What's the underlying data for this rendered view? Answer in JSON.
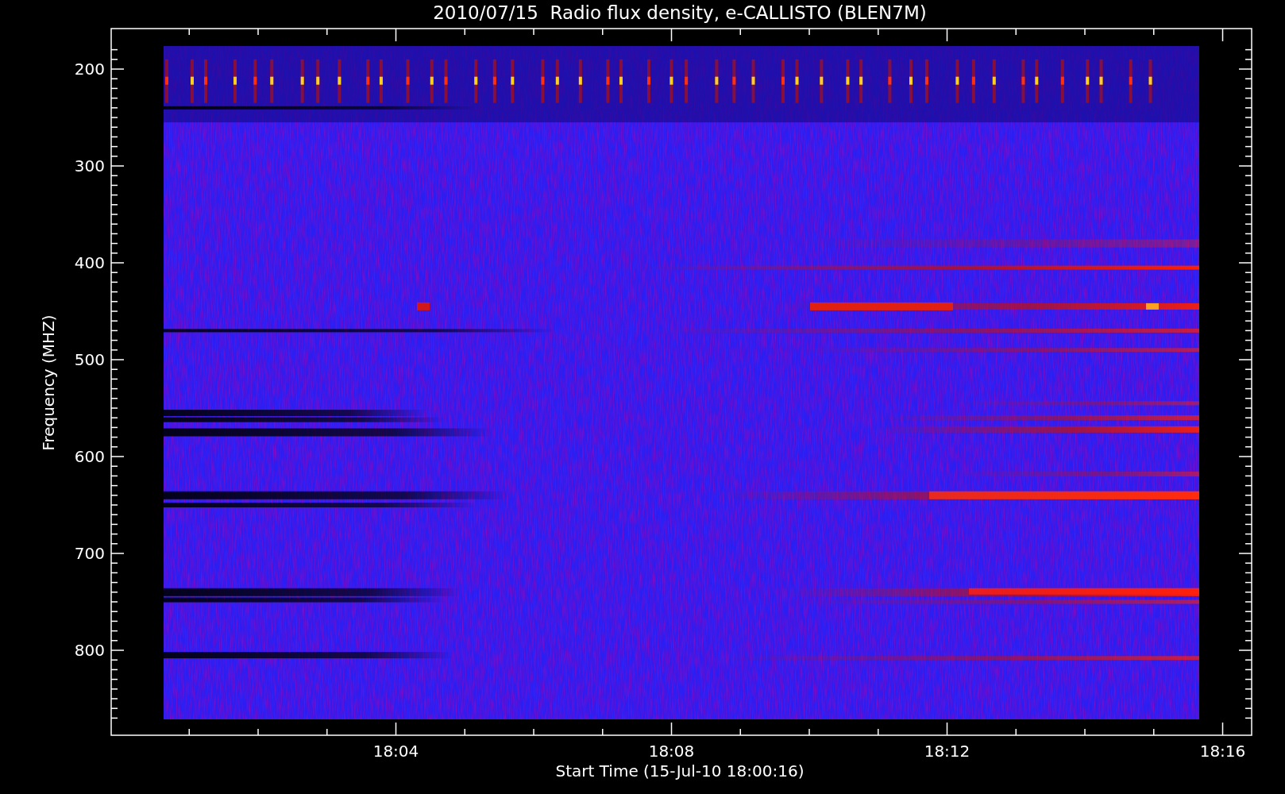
{
  "title": "2010/07/15  Radio flux density, e-CALLISTO (BLEN7M)",
  "y_axis": {
    "label": "Frequency (MHZ)",
    "ticks": [
      "200",
      "300",
      "400",
      "500",
      "600",
      "700",
      "800"
    ]
  },
  "x_axis": {
    "label": "Start Time (15-Jul-10 18:00:16)",
    "ticks": [
      "18:04",
      "18:08",
      "18:12",
      "18:16"
    ]
  }
}
